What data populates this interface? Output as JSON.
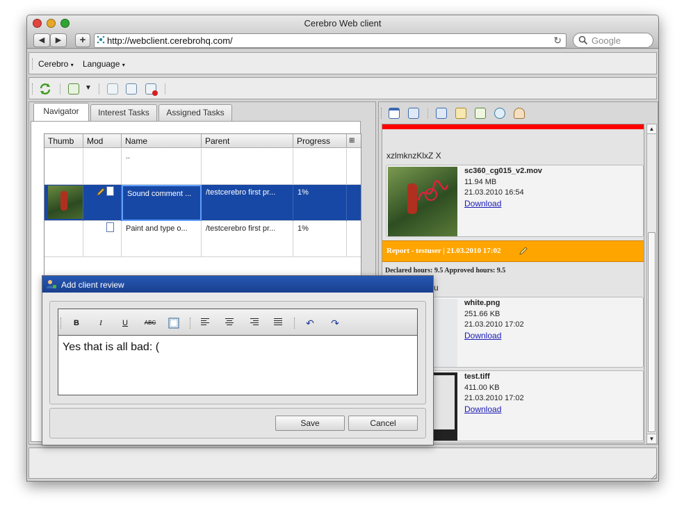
{
  "window": {
    "title": "Cerebro Web client"
  },
  "browser": {
    "url": "http://webclient.cerebrohq.com/",
    "search_placeholder": "Google",
    "back_glyph": "◀",
    "forward_glyph": "▶",
    "add_glyph": "+",
    "reload_glyph": "↻"
  },
  "menu": {
    "items": [
      "Cerebro",
      "Language"
    ]
  },
  "tabs": [
    "Navigator",
    "Interest Tasks",
    "Assigned Tasks"
  ],
  "grid": {
    "columns": [
      "Thumb",
      "Mod",
      "Name",
      "Parent",
      "Progress"
    ],
    "rows": [
      {
        "name": "..",
        "parent": "",
        "progress": ""
      },
      {
        "name": "Sound comment ...",
        "parent": "/testcerebro first pr...",
        "progress": "1%"
      },
      {
        "name": "Paint and type o...",
        "parent": "/testcerebro first pr...",
        "progress": "1%"
      }
    ]
  },
  "feed": {
    "header_text": "xzlmknzKlxZ X",
    "attachments": [
      {
        "name": "sc360_cg015_v2.mov",
        "size": "11.94 MB",
        "date": "21.03.2010 16:54",
        "link": "Download"
      },
      {
        "name": "white.png",
        "size": "251.66 KB",
        "date": "21.03.2010 17:02",
        "link": "Download"
      },
      {
        "name": "test.tiff",
        "size": "411.00 KB",
        "date": "21.03.2010 17:02",
        "link": "Download"
      }
    ],
    "report": {
      "title": "Report - testuser | 21.03.2010 17:02",
      "hours": "Declared hours: 9.5 Approved hours: 9.5",
      "fragment": "u"
    }
  },
  "dialog": {
    "title": "Add client review",
    "text": "Yes that is all bad: (",
    "save_label": "Save",
    "cancel_label": "Cancel",
    "format": {
      "bold": "B",
      "italic": "I",
      "underline": "U",
      "strike": "ABC",
      "undo": "↶",
      "redo": "↷"
    }
  },
  "colors": {
    "selection": "#1848a5",
    "report_header": "#ffa500",
    "alert_bar": "#ff0000",
    "link": "#1a1ab5"
  }
}
